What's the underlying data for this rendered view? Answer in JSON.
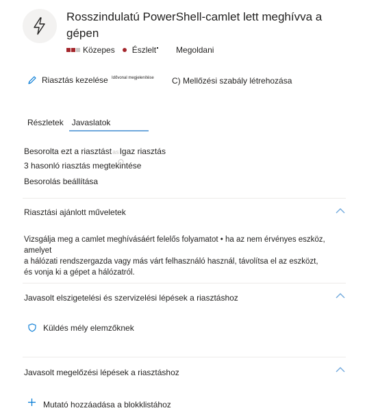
{
  "header": {
    "title": "Rosszindulatú PowerShell-camlet lett meghívva a gépen",
    "severity_label": "Közepes",
    "status_label": "Észlelt",
    "resolve_label": "Megoldani",
    "severity_colors": [
      "#a4262c",
      "#a4262c",
      "#c8c6c4"
    ]
  },
  "actions": {
    "manage_alert": "Riasztás kezelése",
    "timeline_view": "Idővonal megjelenítése",
    "suppression_rule": "C) Mellőzési szabály létrehozása"
  },
  "tabs": [
    {
      "label": "Részletek"
    },
    {
      "label": "Javaslatok"
    }
  ],
  "classification": {
    "classified_as_prefix": "Besorolta ezt a riasztást",
    "classified_value": "Igaz riasztás",
    "similar_alerts": "3 hasonló riasztás megtekintése",
    "classify_settings": "Besorolás beállítása"
  },
  "sections": [
    {
      "title": "Riasztási ajánlott műveletek",
      "body_lines": [
        "Vizsgálja meg a camlet meghívásáért felelős folyamatot • ha az nem érvényes eszköz, amelyet",
        "a hálózati rendszergazda vagy más várt felhasználó használ, távolítsa el az eszközt,",
        "és vonja ki a gépet a hálózatról."
      ]
    },
    {
      "title": "Javasolt elszigetelési és szervizelési lépések a riasztáshoz",
      "item_label": "Küldés mély elemzőknek",
      "item_icon": "shield-icon"
    },
    {
      "title": "Javasolt megelőzési lépések a riasztáshoz",
      "item_label": "Mutató hozzáadása a blokklistához",
      "item_icon": "plus-icon"
    }
  ],
  "icons": {
    "alert": "lightning-icon",
    "manage": "pencil-icon",
    "collapse": "chevron-up-icon"
  },
  "colors": {
    "accent": "#0078d4",
    "chevron": "#6fa8dc",
    "severity_dot": "#a4262c"
  }
}
